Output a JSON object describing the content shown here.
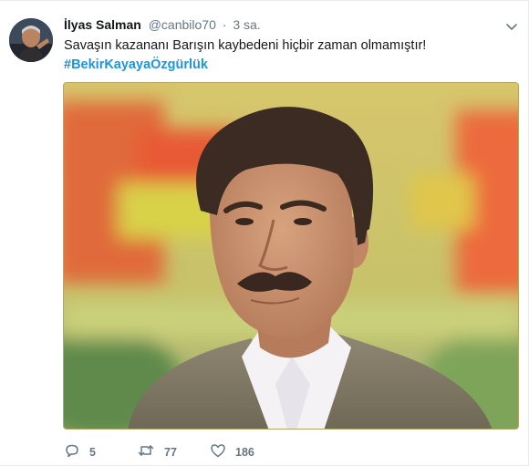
{
  "tweet": {
    "author_name": "İlyas Salman",
    "handle": "@canbilo70",
    "separator": "·",
    "time": "3 sa.",
    "text": "Savaşın kazananı Barışın kaybedeni hiçbir zaman olmamıştır!",
    "hashtag": "#BekirKayayaÖzgürlük"
  },
  "actions": {
    "reply_count": "5",
    "retweet_count": "77",
    "like_count": "186"
  },
  "icons": {
    "reply": "reply-icon",
    "retweet": "retweet-icon",
    "like": "heart-icon",
    "caret": "chevron-down-icon"
  },
  "colors": {
    "hashtag": "#1b95e0",
    "muted": "#657786",
    "text": "#14171a"
  }
}
